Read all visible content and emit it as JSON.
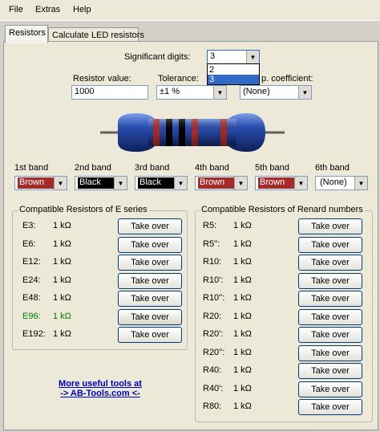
{
  "menu": {
    "file": "File",
    "extras": "Extras",
    "help": "Help"
  },
  "tabs": {
    "resistors": "Resistors",
    "led": "Calculate LED resistors"
  },
  "sig_digits": {
    "label": "Significant digits:",
    "value": "3",
    "options": [
      "2",
      "3"
    ]
  },
  "resistor_value": {
    "label": "Resistor value:",
    "value": "1000"
  },
  "tolerance": {
    "label": "Tolerance:",
    "value": "±1 %"
  },
  "temp_coeff": {
    "label": "p. coefficient:",
    "value": "(None)"
  },
  "bands": [
    {
      "label": "1st band",
      "value": "Brown",
      "color": "#a52a2a",
      "text_color": "#ffffff"
    },
    {
      "label": "2nd band",
      "value": "Black",
      "color": "#000000",
      "text_color": "#ffffff"
    },
    {
      "label": "3rd band",
      "value": "Black",
      "color": "#000000",
      "text_color": "#ffffff"
    },
    {
      "label": "4th band",
      "value": "Brown",
      "color": "#a52a2a",
      "text_color": "#ffffff"
    },
    {
      "label": "5th band",
      "value": "Brown",
      "color": "#a52a2a",
      "text_color": "#ffffff"
    },
    {
      "label": "6th band",
      "value": "(None)",
      "color": "#ffffff",
      "text_color": "#000000"
    }
  ],
  "e_series": {
    "title": "Compatible Resistors of E series",
    "button_label": "Take over",
    "rows": [
      {
        "name": "E3:",
        "value": "1 kΩ"
      },
      {
        "name": "E6:",
        "value": "1 kΩ"
      },
      {
        "name": "E12:",
        "value": "1 kΩ"
      },
      {
        "name": "E24:",
        "value": "1 kΩ"
      },
      {
        "name": "E48:",
        "value": "1 kΩ"
      },
      {
        "name": "E96:",
        "value": "1 kΩ"
      },
      {
        "name": "E192:",
        "value": "1 kΩ"
      }
    ],
    "highlight_color": "#008000"
  },
  "renard": {
    "title": "Compatible Resistors of Renard numbers",
    "button_label": "Take over",
    "rows": [
      {
        "name": "R5:",
        "value": "1 kΩ"
      },
      {
        "name": "R5'':",
        "value": "1 kΩ"
      },
      {
        "name": "R10:",
        "value": "1 kΩ"
      },
      {
        "name": "R10':",
        "value": "1 kΩ"
      },
      {
        "name": "R10'':",
        "value": "1 kΩ"
      },
      {
        "name": "R20:",
        "value": "1 kΩ"
      },
      {
        "name": "R20':",
        "value": "1 kΩ"
      },
      {
        "name": "R20'':",
        "value": "1 kΩ"
      },
      {
        "name": "R40:",
        "value": "1 kΩ"
      },
      {
        "name": "R40':",
        "value": "1 kΩ"
      },
      {
        "name": "R80:",
        "value": "1 kΩ"
      }
    ]
  },
  "link": {
    "line1": "More useful tools at",
    "line2": "-> AB-Tools.com <-"
  }
}
